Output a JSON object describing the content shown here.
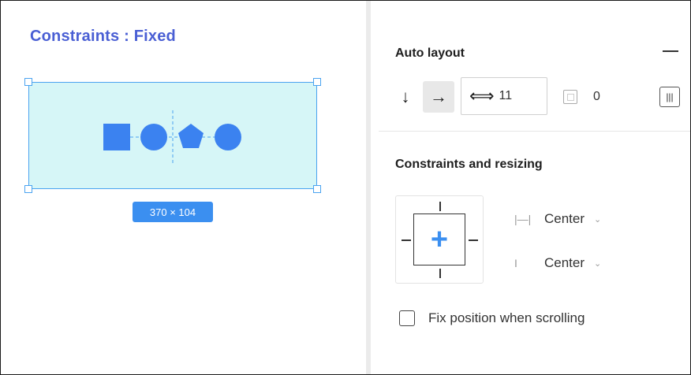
{
  "canvas": {
    "title": "Constraints : Fixed",
    "frame_size_label": "370 × 104",
    "colors": {
      "frame_fill": "#d6f6f7",
      "frame_stroke": "#4aa3f0",
      "shape_fill": "#3b82f0",
      "title": "#4a5fd4"
    },
    "shapes": [
      "square-shape",
      "circle-shape",
      "pentagon-shape",
      "circle-shape"
    ]
  },
  "panel": {
    "auto_layout": {
      "title": "Auto layout",
      "collapse_icon": "minus-icon",
      "direction_vertical_icon": "arrow-down-icon",
      "direction_horizontal_icon": "arrow-right-icon",
      "spacing_value": "11",
      "spacing_icon": "horizontal-spacing-icon",
      "padding_value": "0",
      "padding_icon": "padding-icon",
      "alignment_icon": "alignment-icon"
    },
    "constraints": {
      "title": "Constraints and resizing",
      "horizontal": {
        "value": "Center",
        "icon": "horizontal-constraint-icon"
      },
      "vertical": {
        "value": "Center",
        "icon": "vertical-constraint-icon"
      },
      "fix_position_label": "Fix position when scrolling",
      "fix_position_checked": false
    }
  }
}
